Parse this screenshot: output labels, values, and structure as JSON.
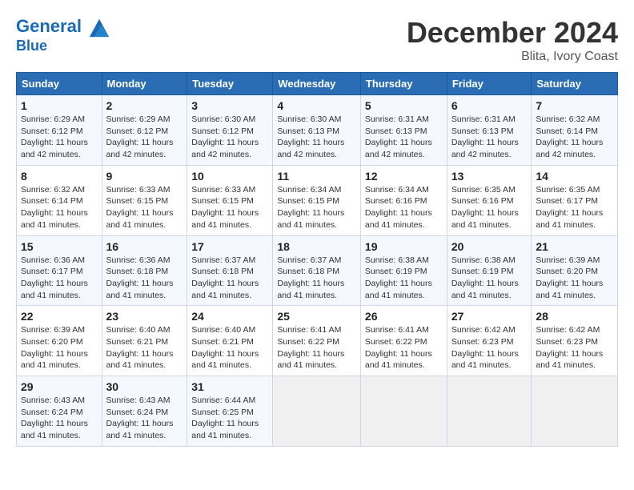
{
  "header": {
    "logo_line1": "General",
    "logo_line2": "Blue",
    "month_title": "December 2024",
    "location": "Blita, Ivory Coast"
  },
  "days_of_week": [
    "Sunday",
    "Monday",
    "Tuesday",
    "Wednesday",
    "Thursday",
    "Friday",
    "Saturday"
  ],
  "weeks": [
    [
      {
        "day": "1",
        "sunrise": "6:29 AM",
        "sunset": "6:12 PM",
        "daylight": "11 hours and 42 minutes."
      },
      {
        "day": "2",
        "sunrise": "6:29 AM",
        "sunset": "6:12 PM",
        "daylight": "11 hours and 42 minutes."
      },
      {
        "day": "3",
        "sunrise": "6:30 AM",
        "sunset": "6:12 PM",
        "daylight": "11 hours and 42 minutes."
      },
      {
        "day": "4",
        "sunrise": "6:30 AM",
        "sunset": "6:13 PM",
        "daylight": "11 hours and 42 minutes."
      },
      {
        "day": "5",
        "sunrise": "6:31 AM",
        "sunset": "6:13 PM",
        "daylight": "11 hours and 42 minutes."
      },
      {
        "day": "6",
        "sunrise": "6:31 AM",
        "sunset": "6:13 PM",
        "daylight": "11 hours and 42 minutes."
      },
      {
        "day": "7",
        "sunrise": "6:32 AM",
        "sunset": "6:14 PM",
        "daylight": "11 hours and 42 minutes."
      }
    ],
    [
      {
        "day": "8",
        "sunrise": "6:32 AM",
        "sunset": "6:14 PM",
        "daylight": "11 hours and 41 minutes."
      },
      {
        "day": "9",
        "sunrise": "6:33 AM",
        "sunset": "6:15 PM",
        "daylight": "11 hours and 41 minutes."
      },
      {
        "day": "10",
        "sunrise": "6:33 AM",
        "sunset": "6:15 PM",
        "daylight": "11 hours and 41 minutes."
      },
      {
        "day": "11",
        "sunrise": "6:34 AM",
        "sunset": "6:15 PM",
        "daylight": "11 hours and 41 minutes."
      },
      {
        "day": "12",
        "sunrise": "6:34 AM",
        "sunset": "6:16 PM",
        "daylight": "11 hours and 41 minutes."
      },
      {
        "day": "13",
        "sunrise": "6:35 AM",
        "sunset": "6:16 PM",
        "daylight": "11 hours and 41 minutes."
      },
      {
        "day": "14",
        "sunrise": "6:35 AM",
        "sunset": "6:17 PM",
        "daylight": "11 hours and 41 minutes."
      }
    ],
    [
      {
        "day": "15",
        "sunrise": "6:36 AM",
        "sunset": "6:17 PM",
        "daylight": "11 hours and 41 minutes."
      },
      {
        "day": "16",
        "sunrise": "6:36 AM",
        "sunset": "6:18 PM",
        "daylight": "11 hours and 41 minutes."
      },
      {
        "day": "17",
        "sunrise": "6:37 AM",
        "sunset": "6:18 PM",
        "daylight": "11 hours and 41 minutes."
      },
      {
        "day": "18",
        "sunrise": "6:37 AM",
        "sunset": "6:18 PM",
        "daylight": "11 hours and 41 minutes."
      },
      {
        "day": "19",
        "sunrise": "6:38 AM",
        "sunset": "6:19 PM",
        "daylight": "11 hours and 41 minutes."
      },
      {
        "day": "20",
        "sunrise": "6:38 AM",
        "sunset": "6:19 PM",
        "daylight": "11 hours and 41 minutes."
      },
      {
        "day": "21",
        "sunrise": "6:39 AM",
        "sunset": "6:20 PM",
        "daylight": "11 hours and 41 minutes."
      }
    ],
    [
      {
        "day": "22",
        "sunrise": "6:39 AM",
        "sunset": "6:20 PM",
        "daylight": "11 hours and 41 minutes."
      },
      {
        "day": "23",
        "sunrise": "6:40 AM",
        "sunset": "6:21 PM",
        "daylight": "11 hours and 41 minutes."
      },
      {
        "day": "24",
        "sunrise": "6:40 AM",
        "sunset": "6:21 PM",
        "daylight": "11 hours and 41 minutes."
      },
      {
        "day": "25",
        "sunrise": "6:41 AM",
        "sunset": "6:22 PM",
        "daylight": "11 hours and 41 minutes."
      },
      {
        "day": "26",
        "sunrise": "6:41 AM",
        "sunset": "6:22 PM",
        "daylight": "11 hours and 41 minutes."
      },
      {
        "day": "27",
        "sunrise": "6:42 AM",
        "sunset": "6:23 PM",
        "daylight": "11 hours and 41 minutes."
      },
      {
        "day": "28",
        "sunrise": "6:42 AM",
        "sunset": "6:23 PM",
        "daylight": "11 hours and 41 minutes."
      }
    ],
    [
      {
        "day": "29",
        "sunrise": "6:43 AM",
        "sunset": "6:24 PM",
        "daylight": "11 hours and 41 minutes."
      },
      {
        "day": "30",
        "sunrise": "6:43 AM",
        "sunset": "6:24 PM",
        "daylight": "11 hours and 41 minutes."
      },
      {
        "day": "31",
        "sunrise": "6:44 AM",
        "sunset": "6:25 PM",
        "daylight": "11 hours and 41 minutes."
      },
      null,
      null,
      null,
      null
    ]
  ]
}
